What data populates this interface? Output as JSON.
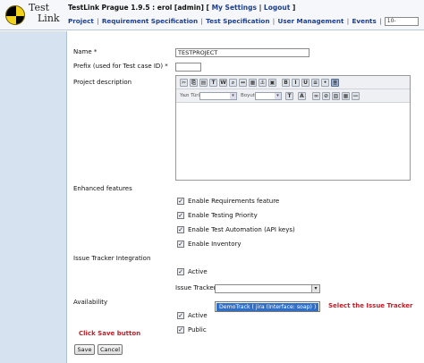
{
  "header": {
    "app_title": "TestLink Prague 1.9.5 : erol [admin]",
    "my_settings": "My Settings",
    "logout": "Logout",
    "logo_line1": "Test",
    "logo_line2": "Link",
    "menu": [
      "Project",
      "Requirement Specification",
      "Test Specification",
      "User Management",
      "Events"
    ],
    "search_value": "10-"
  },
  "form": {
    "name_label": "Name *",
    "name_value": "TESTPROJECT",
    "prefix_label": "Prefix (used for Test case ID) *",
    "prefix_value": "",
    "description_label": "Project description",
    "toolbar": {
      "font_label": "Yazı Türü",
      "size_label": "Boyut"
    },
    "enhanced_label": "Enhanced features",
    "features": [
      {
        "label": "Enable Requirements feature",
        "checked": true
      },
      {
        "label": "Enable Testing Priority",
        "checked": true
      },
      {
        "label": "Enable Test Automation (API keys)",
        "checked": true
      },
      {
        "label": "Enable Inventory",
        "checked": true
      }
    ],
    "issue_tracker_integration_label": "Issue Tracker Integration",
    "issue_active_label": "Active",
    "issue_tracker_label": "Issue Tracker",
    "issue_tracker_value": "",
    "issue_tracker_option": "DemoTrack ( jira (Interface: soap) )",
    "availability_label": "Availability",
    "availability_active_label": "Active",
    "availability_public_label": "Public",
    "save_label": "Save",
    "cancel_label": "Cancel"
  },
  "annotations": {
    "select_issue_tracker": "Select the Issue Tracker",
    "click_save": "Click Save button"
  }
}
